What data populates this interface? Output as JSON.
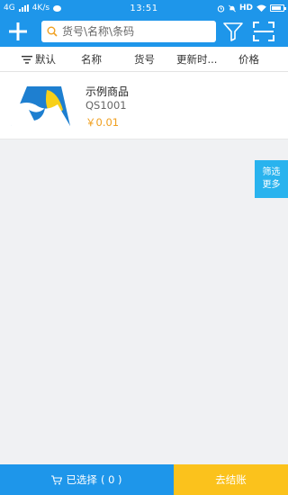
{
  "status_bar": {
    "network": "4G",
    "speed": "4K/s",
    "time": "13:51",
    "hd": "HD"
  },
  "search": {
    "placeholder": "货号\\名称\\条码"
  },
  "sort_bar": {
    "default": "默认",
    "name": "名称",
    "code": "货号",
    "updated": "更新时...",
    "price": "价格"
  },
  "products": [
    {
      "name": "示例商品",
      "code": "QS1001",
      "price": "￥0.01"
    }
  ],
  "more_filter": {
    "line1": "筛选",
    "line2": "更多"
  },
  "bottom": {
    "selected_label": "已选择",
    "selected_count": "( 0 )",
    "checkout_label": "去结账"
  },
  "colors": {
    "primary": "#1e96ea",
    "accent": "#fbc21c",
    "price": "#f0a020",
    "filter_tab": "#29b3ee"
  },
  "icons": [
    "add-icon",
    "search-icon",
    "filter-icon",
    "scan-icon",
    "sort-icon",
    "cart-icon"
  ]
}
